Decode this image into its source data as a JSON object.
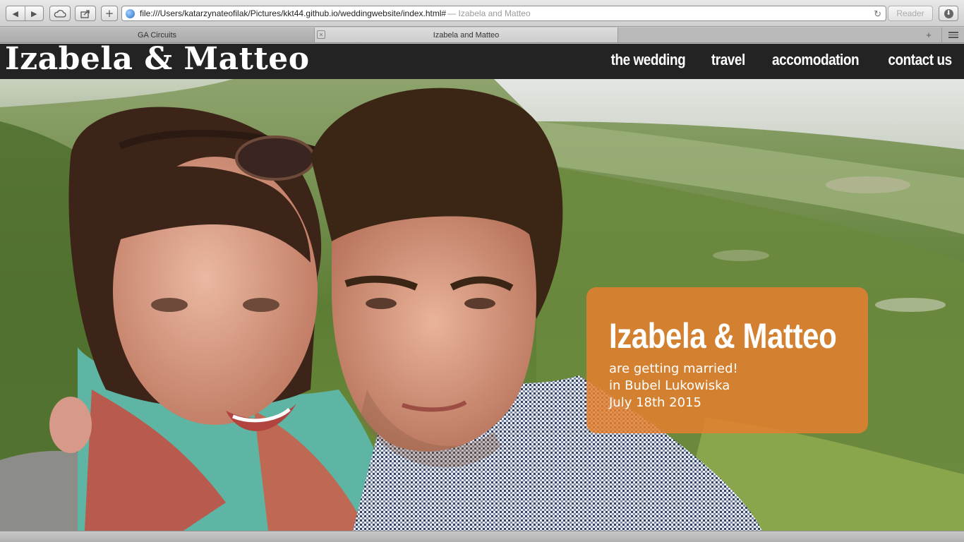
{
  "browser": {
    "url": "file:///Users/katarzynateofilak/Pictures/kkt44.github.io/weddingwebsite/index.html#",
    "url_suffix": "— Izabela and Matteo",
    "reader_label": "Reader",
    "buttons": {
      "back": "◀",
      "forward": "▶",
      "new_tab": "+",
      "reload": "↻"
    },
    "tabs": [
      {
        "label": "GA Circuits",
        "active": false
      },
      {
        "label": "Izabela and Matteo",
        "active": true
      }
    ]
  },
  "site": {
    "logo": "Izabela & Matteo",
    "nav": [
      "the wedding",
      "travel",
      "accomodation",
      "contact us"
    ]
  },
  "hero": {
    "photo_description_icon": "couple-photo",
    "card": {
      "title": "Izabela & Matteo",
      "line1": "are getting married!",
      "line2": "in Bubel Lukowiska",
      "line3": "July 18th 2015"
    }
  },
  "colors": {
    "header_bg": "#232323",
    "card_orange": "#e48030"
  }
}
